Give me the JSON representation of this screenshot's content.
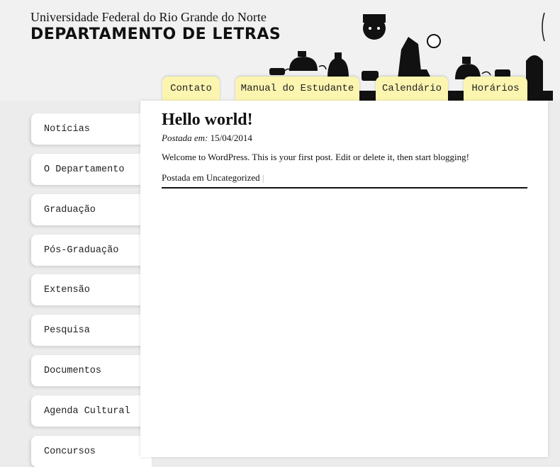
{
  "header": {
    "university": "Universidade Federal do Rio Grande do Norte",
    "department": "DEPARTAMENTO DE LETRAS"
  },
  "nav_tabs": [
    {
      "label": "Contato"
    },
    {
      "label": "Manual do Estudante"
    },
    {
      "label": "Calendário"
    },
    {
      "label": "Horários"
    }
  ],
  "sidebar": {
    "items": [
      {
        "label": "Notícias"
      },
      {
        "label": "O Departamento"
      },
      {
        "label": "Graduação"
      },
      {
        "label": "Pós-Graduação"
      },
      {
        "label": "Extensão"
      },
      {
        "label": "Pesquisa"
      },
      {
        "label": "Documentos"
      },
      {
        "label": "Agenda Cultural"
      },
      {
        "label": "Concursos"
      }
    ]
  },
  "post": {
    "title": "Hello world!",
    "date_label": "Postada em:",
    "date": "15/04/2014",
    "body": "Welcome to WordPress. This is your first post. Edit or delete it, then start blogging!",
    "meta_prefix": "Postada em",
    "category": "Uncategorized",
    "separator": "|"
  },
  "colors": {
    "tab_bg": "#fbf5b0",
    "page_bg": "#ececec",
    "content_bg": "#ffffff"
  }
}
